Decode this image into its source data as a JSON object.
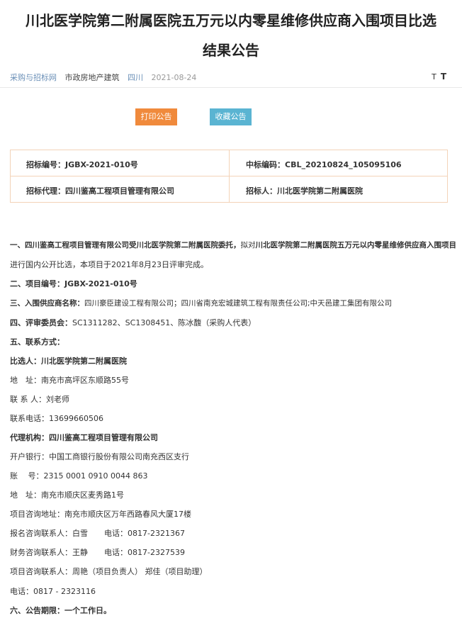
{
  "title": {
    "line1": "川北医学院第二附属医院五万元以内零星维修供应商入围项目比选",
    "line2": "结果公告"
  },
  "meta": {
    "source": "采购与招标网",
    "category": "市政房地产建筑",
    "region": "四川",
    "date": "2021-08-24"
  },
  "fontsize": {
    "small": "T",
    "large": "T"
  },
  "buttons": {
    "print": "打印公告",
    "favorite": "收藏公告"
  },
  "info": {
    "bid_no_label": "招标编号：",
    "bid_no": "JGBX-2021-010号",
    "win_code_label": "中标编码：",
    "win_code": "CBL_20210824_105095106",
    "agent_label": "招标代理：",
    "agent": "四川鉴高工程项目管理有限公司",
    "tenderer_label": "招标人：",
    "tenderer": "川北医学院第二附属医院"
  },
  "content": {
    "p1_bold": "一、四川鉴高工程项目管理有限公司受川北医学院第二附属医院委托，",
    "p1_rest": "拟对",
    "p1_bold2": "川北医学院第二附属医院五万元以内零星维修供应商入围项目",
    "p1_line2": "进行国内公开比选，本项目于2021年8月23日评审完成。",
    "p2": "二、项目编号：JGBX-2021-010号",
    "p3_label": "三、入围供应商名称：",
    "p3_value": "四川豪臣建设工程有限公司；四川省南充宏城建筑工程有限责任公司;中天邑建工集团有限公司",
    "p4_label": "四、评审委员会：",
    "p4_value": "SC1311282、SC1308451、陈冰馥（采购人代表）",
    "p5": "五、联系方式：",
    "p6_label": "比选人：",
    "p6_value": "川北医学院第二附属医院",
    "p7": "地　址：南充市高坪区东顺路55号",
    "p8": "联 系 人：刘老师",
    "p9": "联系电话：13699660506",
    "p10_label": "代理机构：",
    "p10_value": "四川鉴高工程项目管理有限公司",
    "p11": "开户银行：中国工商银行股份有限公司南充西区支行",
    "p12": "账　 号：2315 0001 0910 0044 863",
    "p13": "地　址：南充市顺庆区麦秀路1号",
    "p14": "项目咨询地址：南充市顺庆区万年西路春风大厦17楼",
    "p15a": "报名咨询联系人：白雪",
    "p15b": "电话：0817-2321367",
    "p16a": "财务咨询联系人：王静",
    "p16b": "电话：0817-2327539",
    "p17": "项目咨询联系人：周艳（项目负责人） 郑佳（项目助理）",
    "p18": "电话：0817 - 2323116",
    "p19": "六、公告期限：一个工作日。"
  }
}
